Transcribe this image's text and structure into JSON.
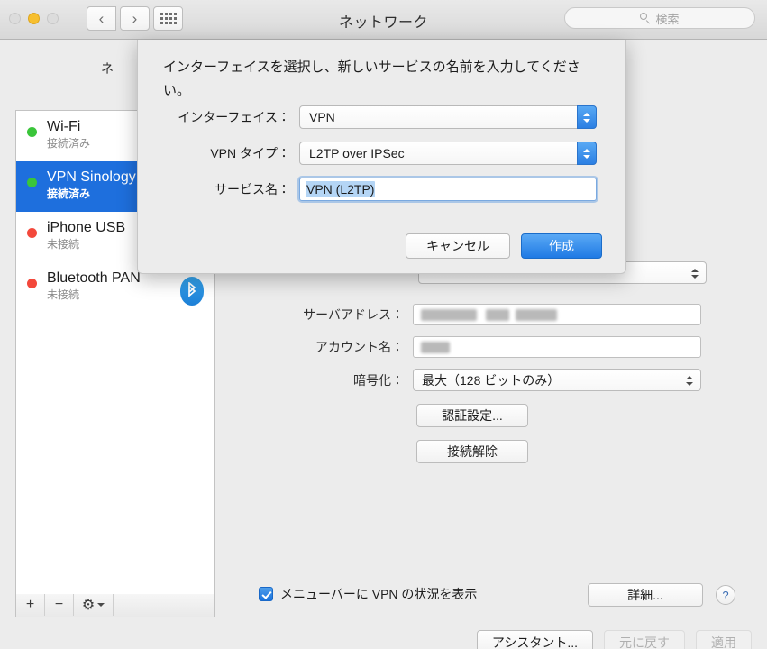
{
  "window": {
    "title": "ネットワーク",
    "traffic_lights": [
      "close",
      "minimize",
      "zoom"
    ],
    "nav_back": "‹",
    "nav_forward": "›"
  },
  "search": {
    "placeholder": "検索"
  },
  "environment": {
    "label": "ネ"
  },
  "sidebar": {
    "services": [
      {
        "name": "Wi-Fi",
        "status": "接続済み",
        "dot": "green",
        "selected": false
      },
      {
        "name": "VPN Sinology",
        "status": "接続済み",
        "dot": "green",
        "selected": true
      },
      {
        "name": "iPhone USB",
        "status": "未接続",
        "dot": "red",
        "selected": false
      },
      {
        "name": "Bluetooth PAN",
        "status": "未接続",
        "dot": "red",
        "selected": false
      }
    ],
    "footer": {
      "add": "+",
      "remove": "−",
      "actions": "⚙"
    }
  },
  "detail": {
    "server_address_label": "サーバアドレス：",
    "account_name_label": "アカウント名：",
    "encryption_label": "暗号化：",
    "encryption_value": "最大（128 ビットのみ）",
    "auth_settings_button": "認証設定...",
    "disconnect_button": "接続解除",
    "menubar_checkbox_label": "メニューバーに VPN の状況を表示",
    "menubar_checkbox_checked": true,
    "advanced_button": "詳細...",
    "help_button": "?"
  },
  "bottom_bar": {
    "assistant_button": "アシスタント...",
    "revert_button": "元に戻す",
    "apply_button": "適用",
    "revert_disabled": true,
    "apply_disabled": true
  },
  "sheet": {
    "message": "インターフェイスを選択し、新しいサービスの名前を入力してください。",
    "interface_label": "インターフェイス：",
    "interface_value": "VPN",
    "vpn_type_label": "VPN タイプ：",
    "vpn_type_value": "L2TP over IPSec",
    "service_name_label": "サービス名：",
    "service_name_value": "VPN (L2TP)",
    "cancel_button": "キャンセル",
    "create_button": "作成"
  },
  "colors": {
    "accent_blue": "#1f7ae4",
    "selection_blue": "#1e6fdd",
    "status_green": "#3ac53a",
    "status_red": "#f3483b",
    "bluetooth_blue": "#1d7fd6"
  }
}
